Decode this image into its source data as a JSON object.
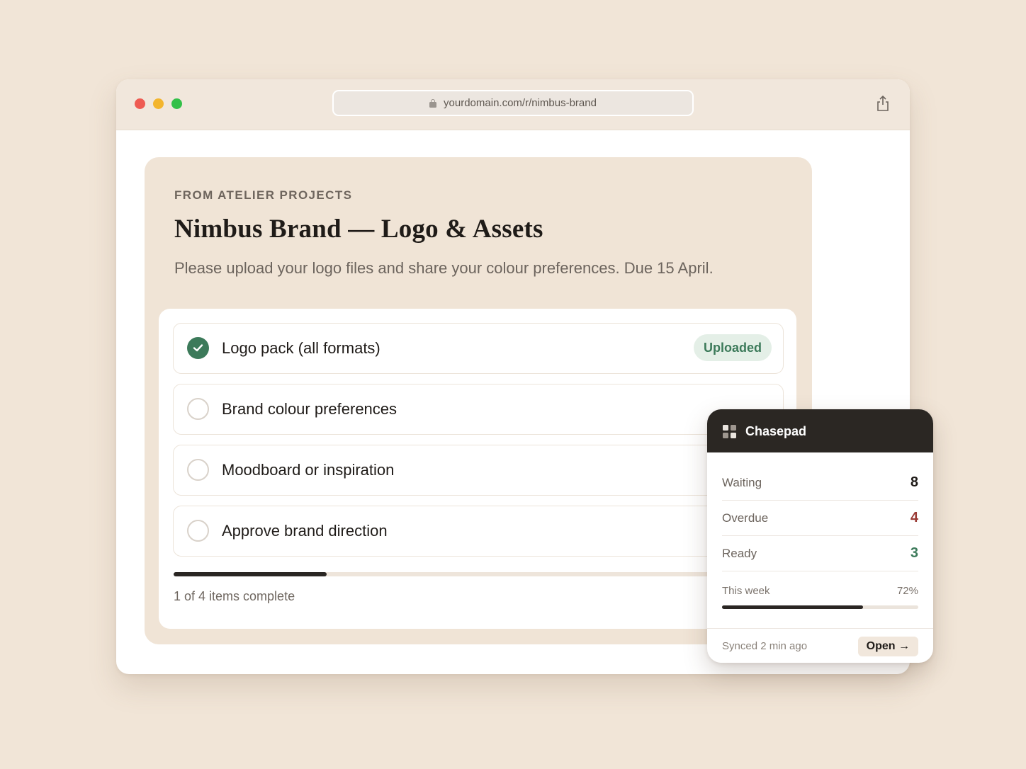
{
  "browser": {
    "url": "yourdomain.com/r/nimbus-brand"
  },
  "request": {
    "eyebrow": "FROM ATELIER PROJECTS",
    "title": "Nimbus Brand — Logo & Assets",
    "description": "Please upload your logo files and share your colour preferences. Due 15 April.",
    "items": [
      {
        "label": "Logo pack (all formats)",
        "status": "done",
        "badge": "Uploaded"
      },
      {
        "label": "Brand colour preferences",
        "status": "todo"
      },
      {
        "label": "Moodboard or inspiration",
        "status": "todo"
      },
      {
        "label": "Approve brand direction",
        "status": "todo"
      }
    ],
    "progress_fraction": 0.25,
    "progress_text": "1 of 4 items complete"
  },
  "widget": {
    "title": "Chasepad",
    "icon": "grid-icon",
    "stats": [
      {
        "label": "Waiting",
        "value": "8",
        "color": "#1f1b18"
      },
      {
        "label": "Overdue",
        "value": "4",
        "color": "#9a3b35"
      },
      {
        "label": "Ready",
        "value": "3",
        "color": "#3c7a5a"
      }
    ],
    "week_label": "This week",
    "week_pct": "72%",
    "week_fraction": 0.72,
    "synced": "Synced 2 min ago",
    "open_label": "Open →"
  },
  "colors": {
    "background": "#f1e5d7",
    "accent_green": "#3c7a5a",
    "overdue_red": "#9a3b35",
    "dark": "#2b2723"
  }
}
